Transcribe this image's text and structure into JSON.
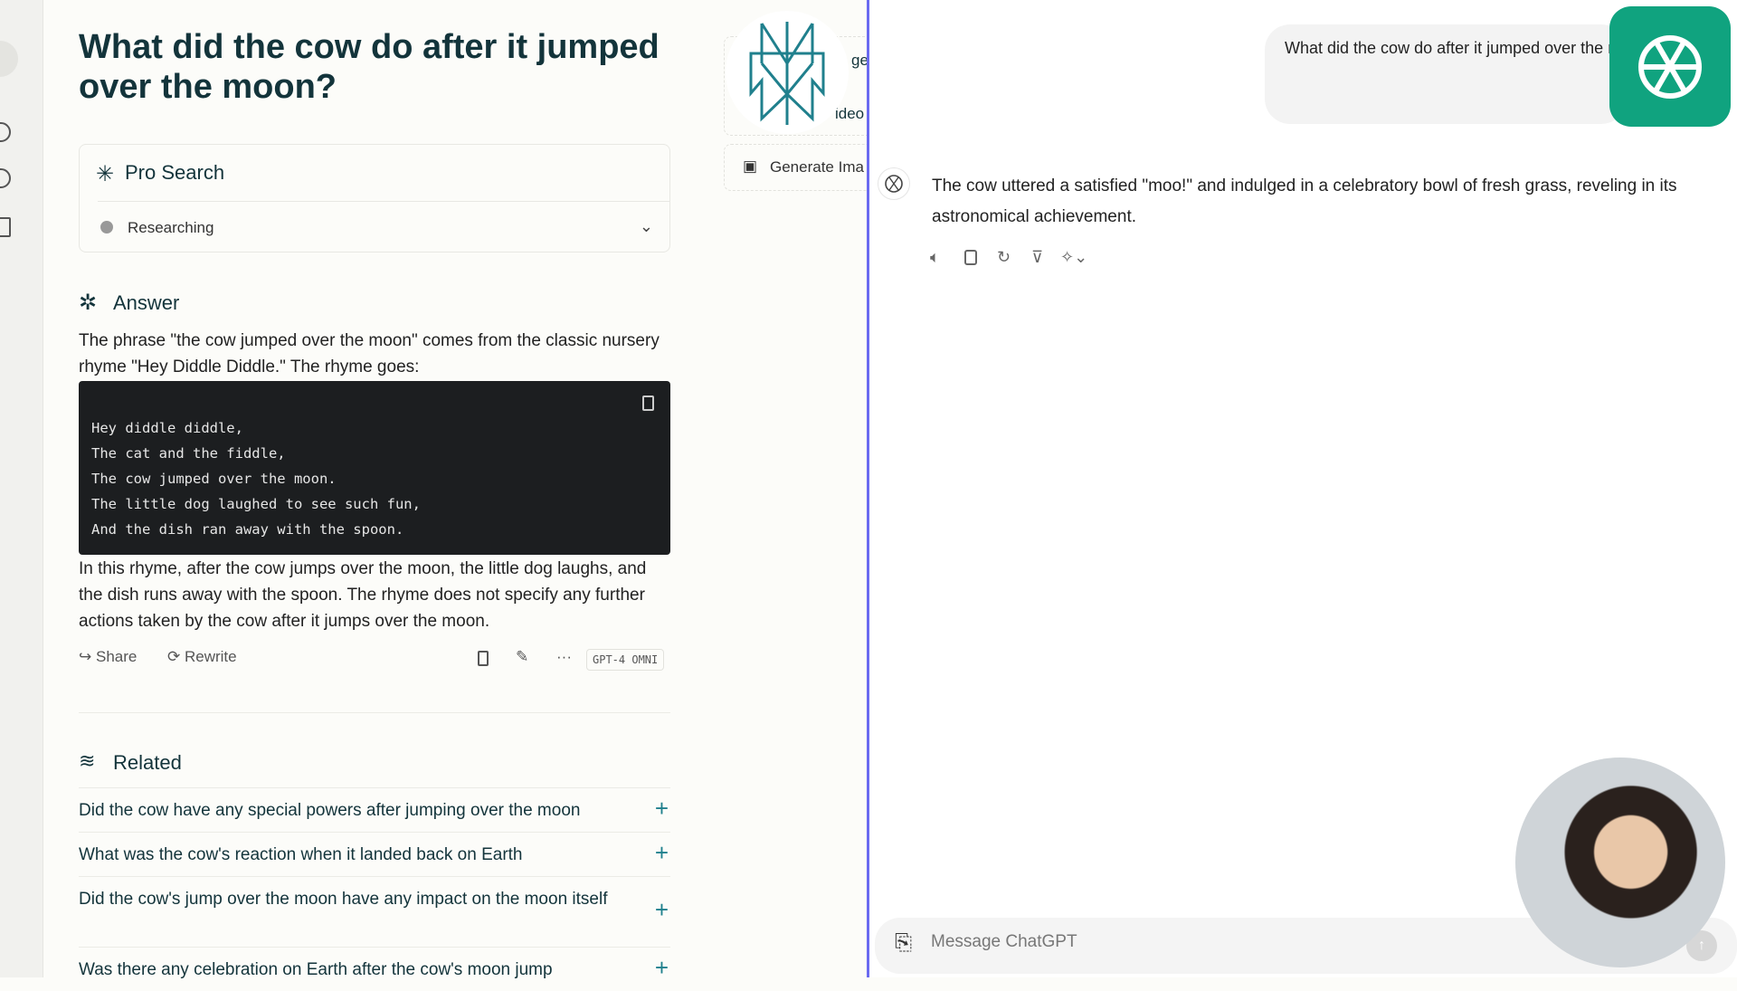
{
  "perplexity": {
    "title": "What did the cow do after it jumped over the moon?",
    "pro_search": {
      "label": "Pro Search",
      "step": "Researching"
    },
    "answer_label": "Answer",
    "intro": "The phrase \"the cow jumped over the moon\" comes from the classic nursery rhyme \"Hey Diddle Diddle.\" The rhyme goes:",
    "code_lines": [
      "Hey diddle diddle,",
      "The cat and the fiddle,",
      "The cow jumped over the moon.",
      "The little dog laughed to see such fun,",
      "And the dish ran away with the spoon."
    ],
    "outro": "In this rhyme, after the cow jumps over the moon, the little dog laughs, and the dish runs away with the spoon. The rhyme does not specify any further actions taken by the cow after it jumps over the moon.",
    "actions": {
      "share": "Share",
      "rewrite": "Rewrite",
      "model": "GPT-4 OMNI"
    },
    "related_label": "Related",
    "related": [
      "Did the cow have any special powers after jumping over the moon",
      "What was the cow's reaction when it landed back on Earth",
      "Did the cow's jump over the moon have any impact on the moon itself",
      "Was there any celebration on Earth after the cow's moon jump"
    ],
    "side": {
      "partial_1": "ge",
      "partial_2": "ideo",
      "generate_image": "Generate Ima"
    },
    "accent": "#20808d"
  },
  "chatgpt": {
    "user_message": "What did the cow do after it jumped over the moon?",
    "assistant_message": "The cow uttered a satisfied \"moo!\" and indulged in a celebratory bowl of fresh grass, reveling in its astronomical achievement.",
    "input_placeholder": "Message ChatGPT",
    "brand_color": "#10a37f"
  }
}
